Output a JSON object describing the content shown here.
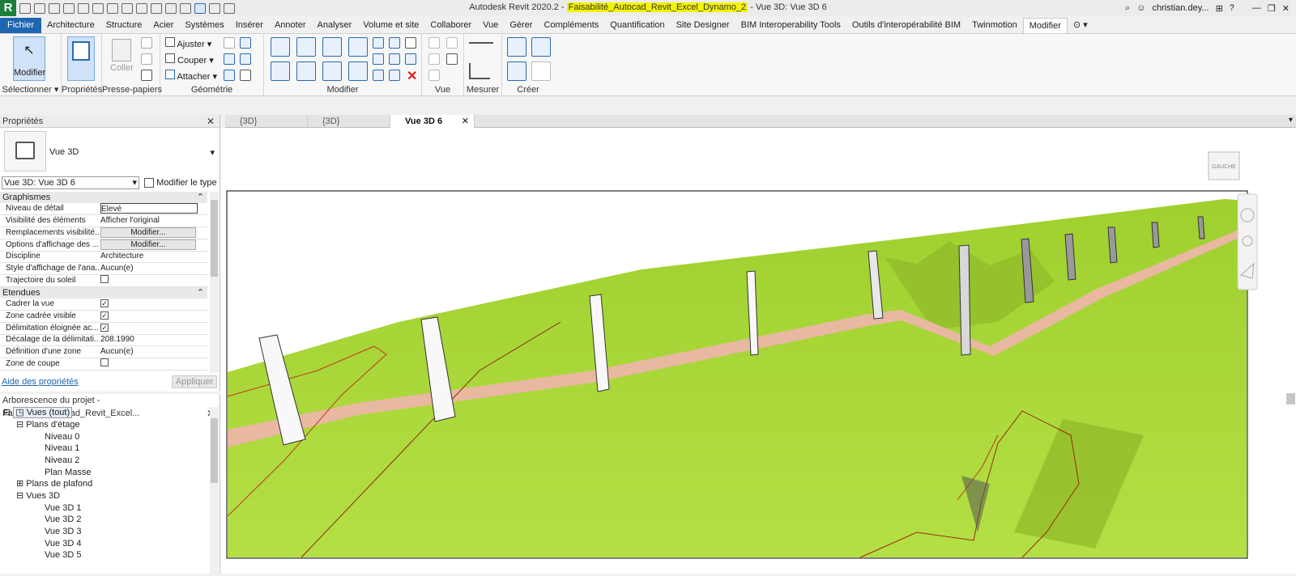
{
  "title": {
    "app": "Autodesk Revit 2020.2 - ",
    "file": "Faisabilité_Autocad_Revit_Excel_Dynamo_2",
    "view": " - Vue 3D: Vue 3D 6"
  },
  "user": "christian.dey...",
  "menu": [
    "Fichier",
    "Architecture",
    "Structure",
    "Acier",
    "Systèmes",
    "Insérer",
    "Annoter",
    "Analyser",
    "Volume et site",
    "Collaborer",
    "Vue",
    "Gérer",
    "Compléments",
    "Quantification",
    "Site Designer",
    "BIM Interoperability Tools",
    "Outils d'interopérabilité BIM",
    "Twinmotion",
    "Modifier"
  ],
  "ribbon": {
    "modify_label": "Modifier",
    "select_label": "Sélectionner",
    "properties_label": "Propriétés",
    "clipboard_label": "Presse-papiers",
    "paste_label": "Coller",
    "geometry_label": "Géométrie",
    "adjust": "Ajuster",
    "cut": "Couper",
    "attach": "Attacher",
    "modify_panel_label": "Modifier",
    "view_label": "Vue",
    "measure_label": "Mesurer",
    "create_label": "Créer"
  },
  "tabs": [
    {
      "label": "{3D}"
    },
    {
      "label": "{3D}"
    },
    {
      "label": "Vue 3D 6"
    }
  ],
  "properties": {
    "header": "Propriétés",
    "type_name": "Vue 3D",
    "selector": "Vue 3D: Vue 3D 6",
    "edit_type": "Modifier le type",
    "group1": "Graphismes",
    "rows1": [
      {
        "k": "Niveau de détail",
        "v": "Elevé"
      },
      {
        "k": "Visibilité des éléments",
        "v": "Afficher l'original"
      },
      {
        "k": "Remplacements visibilité...",
        "v": "Modifier..."
      },
      {
        "k": "Options d'affichage des ...",
        "v": "Modifier..."
      },
      {
        "k": "Discipline",
        "v": "Architecture"
      },
      {
        "k": "Style d'affichage de l'ana...",
        "v": "Aucun(e)"
      },
      {
        "k": "Trajectoire du soleil",
        "v": ""
      }
    ],
    "group2": "Etendues",
    "rows2": [
      {
        "k": "Cadrer la vue",
        "v": "✓"
      },
      {
        "k": "Zone cadrée visible",
        "v": "✓"
      },
      {
        "k": "Délimitation éloignée ac...",
        "v": "✓"
      },
      {
        "k": "Décalage de la délimitati...",
        "v": "208.1990"
      },
      {
        "k": "Définition d'une zone",
        "v": "Aucun(e)"
      },
      {
        "k": "Zone de coupe",
        "v": ""
      }
    ],
    "help": "Aide des propriétés",
    "apply": "Appliquer"
  },
  "tree": {
    "header": "Arborescence du projet - Faisabilité_Autocad_Revit_Excel...",
    "nodes": [
      {
        "label": "Vues (tout)",
        "indent": 0
      },
      {
        "label": "Plans d'étage",
        "indent": 1
      },
      {
        "label": "Niveau 0",
        "indent": 2
      },
      {
        "label": "Niveau 1",
        "indent": 2
      },
      {
        "label": "Niveau 2",
        "indent": 2
      },
      {
        "label": "Plan Masse",
        "indent": 2
      },
      {
        "label": "Plans de plafond",
        "indent": 1
      },
      {
        "label": "Vues 3D",
        "indent": 1
      },
      {
        "label": "Vue 3D 1",
        "indent": 2
      },
      {
        "label": "Vue 3D 2",
        "indent": 2
      },
      {
        "label": "Vue 3D 3",
        "indent": 2
      },
      {
        "label": "Vue 3D 4",
        "indent": 2
      },
      {
        "label": "Vue 3D 5",
        "indent": 2
      }
    ]
  },
  "viewcube_label": "GAUCHE",
  "colors": {
    "terrain": "#a8d43a",
    "path": "#e8b8a0",
    "file_menu": "#1e66b0",
    "highlight": "#f4f400"
  }
}
